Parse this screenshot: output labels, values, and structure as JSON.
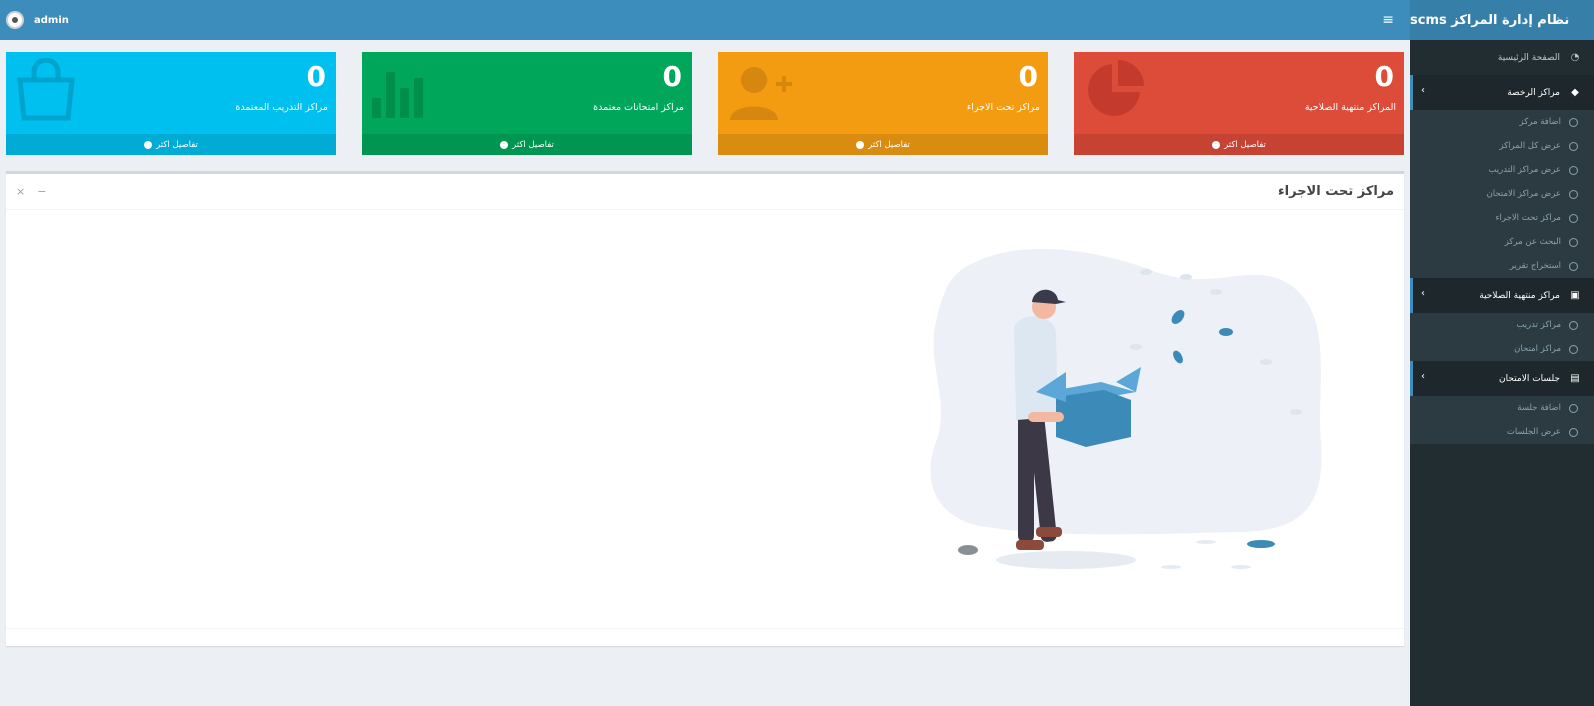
{
  "app": {
    "title": "نظام إدارة المراكز scms"
  },
  "topbar": {
    "username": "admin"
  },
  "sidebar": {
    "home": "الصفحة الرئيسية",
    "sections": [
      {
        "label": "مراكز الرخصة",
        "items": [
          "اضافة مركز",
          "عرض كل المراكز",
          "عرض مراكز التدريب",
          "عرض مراكز الامتحان",
          "مراكز تحت الاجراء",
          "البحث عن مركز",
          "استخراج تقرير"
        ]
      },
      {
        "label": "مراكز منتهية الصلاحية",
        "items": [
          "مراكز تدريب",
          "مراكز امتحان"
        ]
      },
      {
        "label": "جلسات الامتحان",
        "items": [
          "اضافة جلسة",
          "عرض الجلسات"
        ]
      }
    ]
  },
  "boxes": [
    {
      "value": "0",
      "label": "المراكز منتهية الصلاحية",
      "link": "تفاصيل اكثر",
      "color": "#dd4b39",
      "icon": "pie-chart-icon"
    },
    {
      "value": "0",
      "label": "مراكز تحت الاجراء",
      "link": "تفاصيل اكثر",
      "color": "#f39c12",
      "icon": "user-plus-icon"
    },
    {
      "value": "0",
      "label": "مراكز امتحانات معتمدة",
      "link": "تفاصيل اكثر",
      "color": "#00a65a",
      "icon": "bar-chart-icon"
    },
    {
      "value": "0",
      "label": "مراكز التدريب المعتمدة",
      "link": "تفاصيل اكثر",
      "color": "#00c0ef",
      "icon": "shopping-bag-icon"
    }
  ],
  "panel": {
    "title": "مراكز تحت الاجراء"
  }
}
